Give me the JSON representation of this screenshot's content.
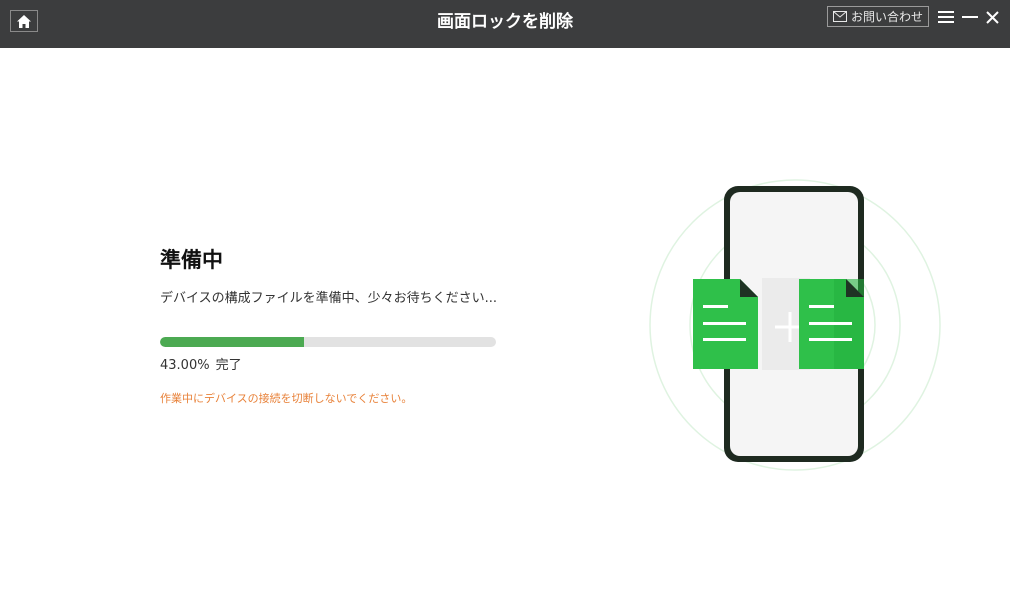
{
  "titlebar": {
    "title": "画面ロックを削除",
    "contact_label": "お問い合わせ",
    "icons": {
      "home": "home-icon",
      "mail": "mail-icon",
      "menu": "menu-icon",
      "minimize": "minimize-icon",
      "close": "close-icon"
    }
  },
  "status": {
    "title": "準備中",
    "description": "デバイスの構成ファイルを準備中、少々お待ちください...",
    "progress_fraction": 0.43,
    "progress_percent": "43.00%",
    "progress_suffix": "完了",
    "warning": "作業中にデバイスの接続を切断しないでください。"
  },
  "colors": {
    "titlebar_bg": "#3c3d3e",
    "progress_fill": "#4caa52",
    "progress_track": "#e2e2e2",
    "warning_text": "#e8823a",
    "file_green": "#2fc04a",
    "phone_frame": "#1e2a20"
  }
}
